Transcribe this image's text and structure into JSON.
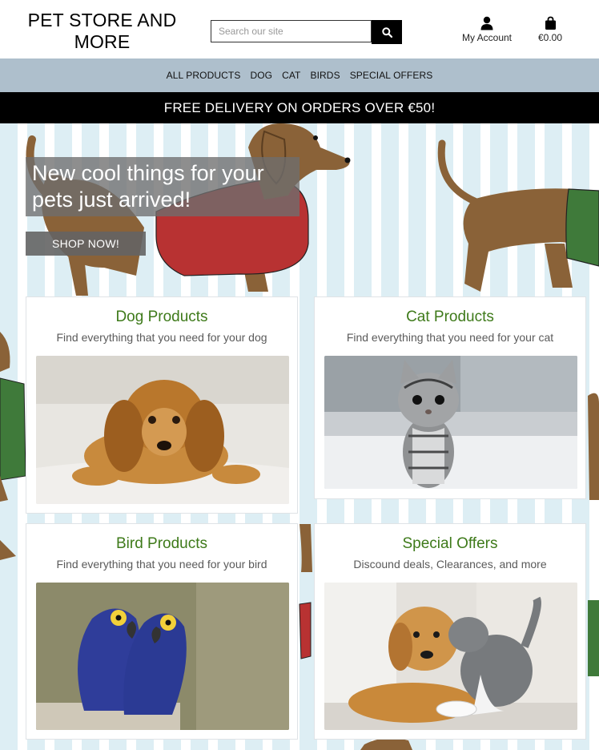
{
  "header": {
    "brand": "PET STORE AND MORE",
    "search_placeholder": "Search our site",
    "account_label": "My Account",
    "bag_total": "€0.00"
  },
  "nav": {
    "items": [
      "ALL PRODUCTS",
      "DOG",
      "CAT",
      "BIRDS",
      "SPECIAL OFFERS"
    ]
  },
  "banner": "FREE DELIVERY ON ORDERS OVER €50!",
  "hero": {
    "headline": "New cool things for your pets just arrived!",
    "cta": "SHOP NOW!"
  },
  "categories": [
    {
      "title": "Dog Products",
      "subtitle": "Find everything that you need for your dog",
      "image": "puppy-photo"
    },
    {
      "title": "Cat Products",
      "subtitle": "Find everything that you need for your cat",
      "image": "kitten-photo"
    },
    {
      "title": "Bird Products",
      "subtitle": "Find everything that you need for your bird",
      "image": "parrots-photo"
    },
    {
      "title": "Special Offers",
      "subtitle": "Discound deals, Clearances, and more",
      "image": "dog-and-cat-photo"
    }
  ],
  "colors": {
    "nav_bg": "#aebfcc",
    "banner_bg": "#000000",
    "card_title": "#3e7a1a",
    "dog_body": "#8a6238",
    "dog_coat_red": "#b83232",
    "dog_coat_green": "#3f7a3a"
  }
}
